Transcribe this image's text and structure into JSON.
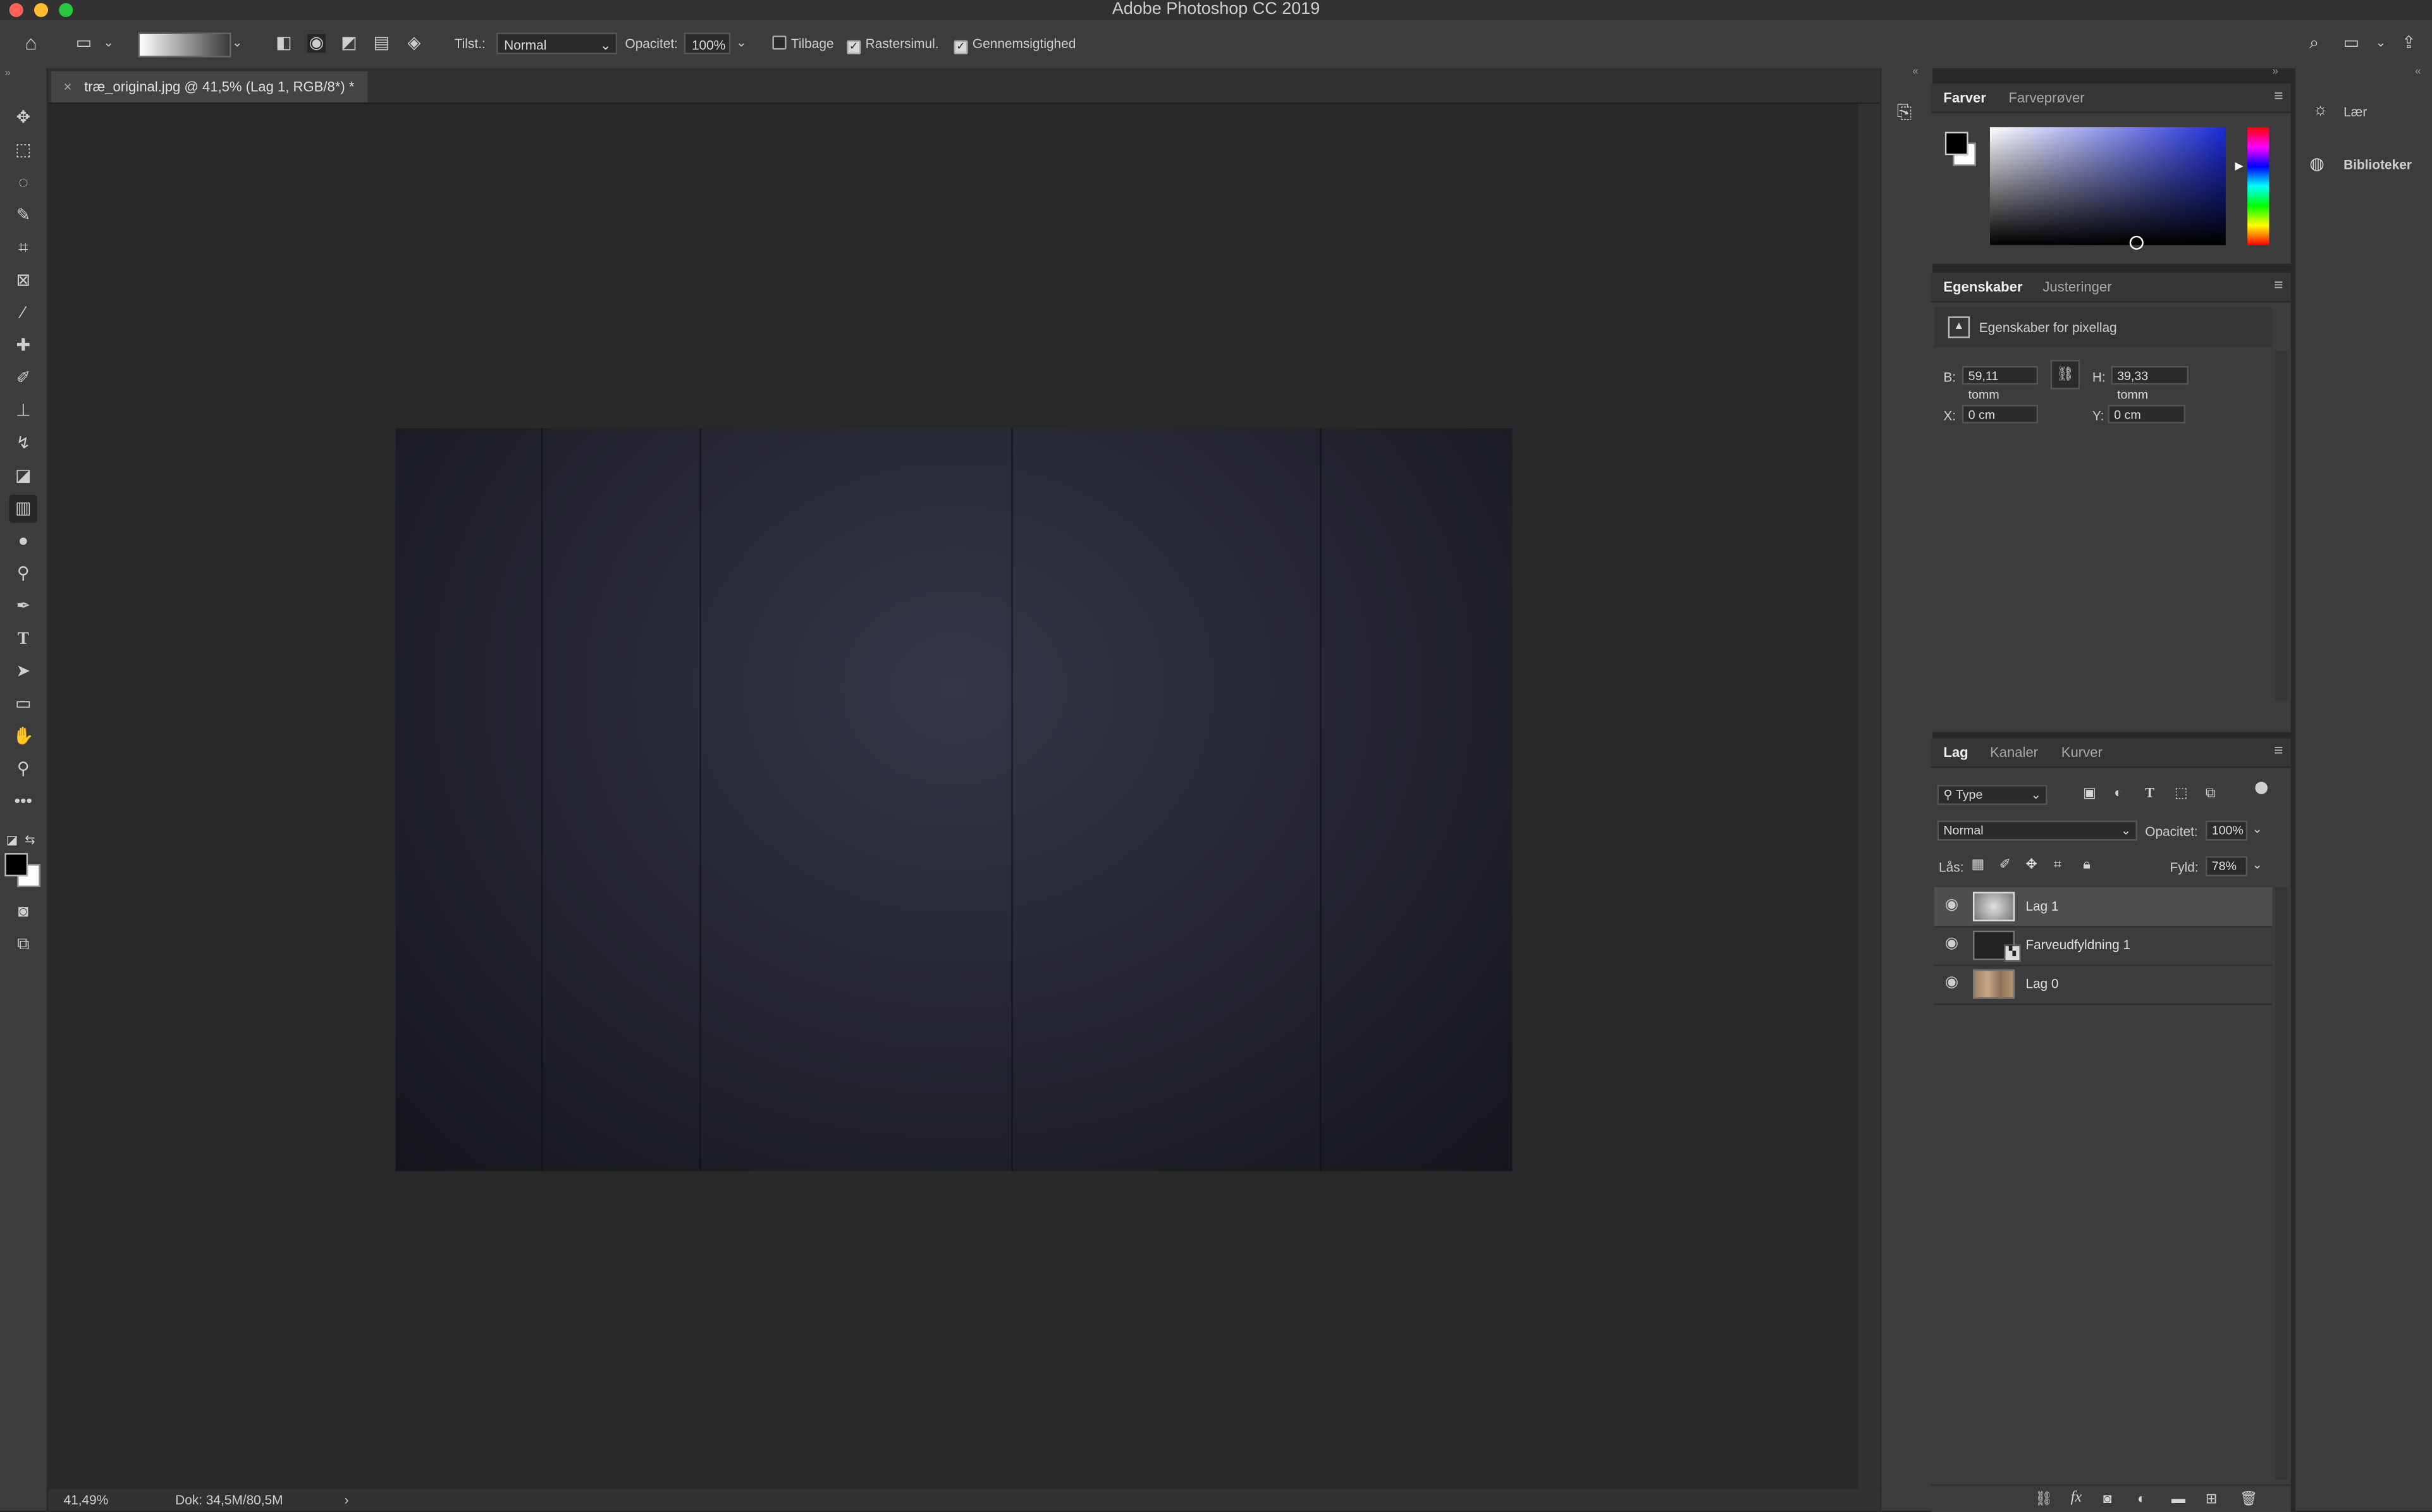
{
  "window": {
    "title": "Adobe Photoshop CC 2019"
  },
  "options_bar": {
    "mode_label": "Tilst.:",
    "mode_value": "Normal",
    "opacity_label": "Opacitet:",
    "opacity_value": "100%",
    "reverse_label": "Tilbage",
    "reverse_checked": false,
    "dither_label": "Rastersimul.",
    "dither_checked": true,
    "transparency_label": "Gennemsigtighed",
    "transparency_checked": true
  },
  "document": {
    "tab_title": "træ_original.jpg @ 41,5% (Lag 1, RGB/8*) *",
    "close_glyph": "×"
  },
  "status": {
    "zoom": "41,49%",
    "doc_info": "Dok: 34,5M/80,5M",
    "arrow": "›"
  },
  "colors_panel": {
    "tabs": [
      "Farver",
      "Farveprøver"
    ],
    "active_tab": "Farver",
    "foreground": "#000000",
    "background": "#ffffff"
  },
  "properties_panel": {
    "tabs": [
      "Egenskaber",
      "Justeringer"
    ],
    "active_tab": "Egenskaber",
    "heading": "Egenskaber for pixellag",
    "w_label": "B:",
    "w_value": "59,11 tomm",
    "h_label": "H:",
    "h_value": "39,33 tomm",
    "x_label": "X:",
    "x_value": "0 cm",
    "y_label": "Y:",
    "y_value": "0 cm"
  },
  "layers_panel": {
    "tabs": [
      "Lag",
      "Kanaler",
      "Kurver"
    ],
    "active_tab": "Lag",
    "filter_value": "Type",
    "blend_mode": "Normal",
    "opacity_label": "Opacitet:",
    "opacity_value": "100%",
    "lock_label": "Lås:",
    "fill_label": "Fyld:",
    "fill_value": "78%",
    "layers": [
      {
        "name": "Lag 1",
        "selected": true
      },
      {
        "name": "Farveudfyldning 1",
        "selected": false
      },
      {
        "name": "Lag 0",
        "selected": false
      }
    ],
    "footer_icons": [
      "link-icon",
      "fx-icon",
      "mask-icon",
      "adjustment-icon",
      "folder-icon",
      "new-layer-icon",
      "trash-icon"
    ],
    "fx_label": "fx"
  },
  "side_panels": {
    "learn": "Lær",
    "libraries": "Biblioteker"
  },
  "tools": [
    "move",
    "marquee",
    "lasso",
    "quick-select",
    "crop",
    "frame",
    "eyedropper",
    "healing",
    "brush",
    "stamp",
    "history-brush",
    "eraser",
    "gradient",
    "blur",
    "dodge",
    "pen",
    "type",
    "path-select",
    "rectangle",
    "hand",
    "zoom",
    "more"
  ],
  "active_tool": "gradient"
}
